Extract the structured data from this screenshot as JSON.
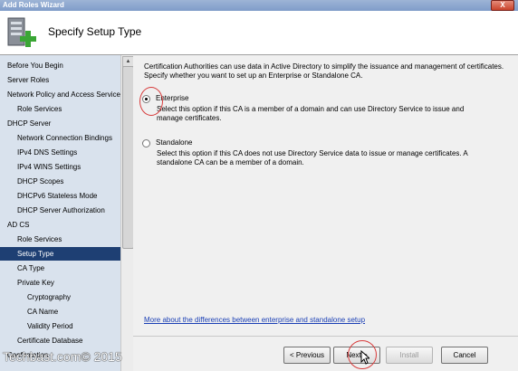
{
  "window": {
    "title": "Add Roles Wizard",
    "close_label": "X"
  },
  "header": {
    "title": "Specify Setup Type",
    "icon": "server-add-icon"
  },
  "nav": {
    "items": [
      {
        "label": "Before You Begin",
        "indent": 0,
        "selected": false
      },
      {
        "label": "Server Roles",
        "indent": 0,
        "selected": false
      },
      {
        "label": "Network Policy and Access Services",
        "indent": 0,
        "selected": false
      },
      {
        "label": "Role Services",
        "indent": 1,
        "selected": false
      },
      {
        "label": "DHCP Server",
        "indent": 0,
        "selected": false
      },
      {
        "label": "Network Connection Bindings",
        "indent": 1,
        "selected": false
      },
      {
        "label": "IPv4 DNS Settings",
        "indent": 1,
        "selected": false
      },
      {
        "label": "IPv4 WINS Settings",
        "indent": 1,
        "selected": false
      },
      {
        "label": "DHCP Scopes",
        "indent": 1,
        "selected": false
      },
      {
        "label": "DHCPv6 Stateless Mode",
        "indent": 1,
        "selected": false
      },
      {
        "label": "DHCP Server Authorization",
        "indent": 1,
        "selected": false
      },
      {
        "label": "AD CS",
        "indent": 0,
        "selected": false
      },
      {
        "label": "Role Services",
        "indent": 1,
        "selected": false
      },
      {
        "label": "Setup Type",
        "indent": 1,
        "selected": true
      },
      {
        "label": "CA Type",
        "indent": 1,
        "selected": false
      },
      {
        "label": "Private Key",
        "indent": 1,
        "selected": false
      },
      {
        "label": "Cryptography",
        "indent": 2,
        "selected": false
      },
      {
        "label": "CA Name",
        "indent": 2,
        "selected": false
      },
      {
        "label": "Validity Period",
        "indent": 2,
        "selected": false
      },
      {
        "label": "Certificate Database",
        "indent": 1,
        "selected": false
      },
      {
        "label": "Confirmation",
        "indent": 0,
        "selected": false
      }
    ]
  },
  "content": {
    "description": "Certification Authorities can use data in Active Directory to simplify the issuance and management of certificates. Specify whether you want to set up an Enterprise or Standalone CA.",
    "options": [
      {
        "label": "Enterprise",
        "selected": true,
        "description": "Select this option if this CA is a member of a domain and can use Directory Service to issue and manage certificates."
      },
      {
        "label": "Standalone",
        "selected": false,
        "description": "Select this option if this CA does not use Directory Service data to issue or manage certificates. A standalone CA can be a member of a domain."
      }
    ],
    "link": "More about the differences between enterprise and standalone setup"
  },
  "buttons": {
    "previous": "< Previous",
    "next": "Next >",
    "install": "Install",
    "cancel": "Cancel"
  },
  "watermark": "Techbast.com© 2015",
  "colors": {
    "selected_nav": "#1e3f73",
    "nav_bg": "#d9e2ed",
    "link": "#1a3fb5",
    "annotation": "#d73c3c"
  }
}
